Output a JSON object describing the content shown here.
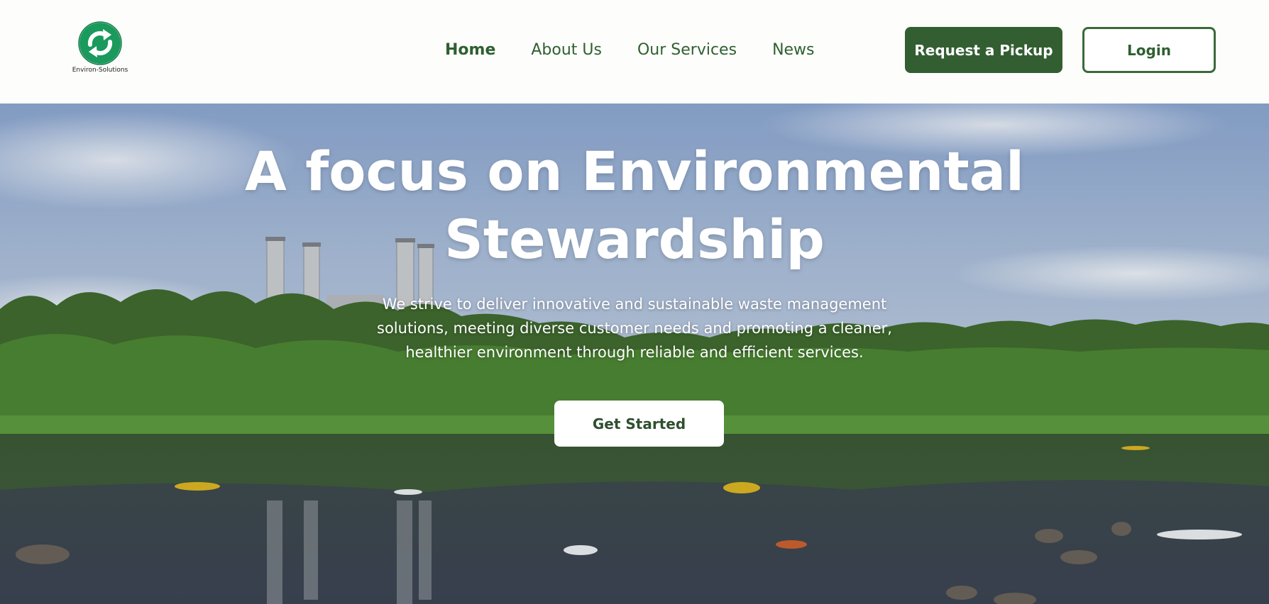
{
  "brand": {
    "name": "Environ-Solutions",
    "logo_icon": "recycle-arrows-icon",
    "logo_color": "#1a9a5c"
  },
  "nav": {
    "items": [
      {
        "label": "Home",
        "active": true
      },
      {
        "label": "About Us",
        "active": false
      },
      {
        "label": "Our Services",
        "active": false
      },
      {
        "label": "News",
        "active": false
      }
    ]
  },
  "header_actions": {
    "pickup_label": "Request a Pickup",
    "login_label": "Login"
  },
  "hero": {
    "title": "A focus on Environmental Stewardship",
    "subtitle": "We strive to deliver innovative and sustainable waste management solutions, meeting diverse customer needs and promoting a cleaner, healthier environment through reliable and efficient services.",
    "cta_label": "Get Started"
  },
  "colors": {
    "brand_green": "#335e32",
    "nav_text": "#2f5f31",
    "header_bg": "#fdfefb"
  }
}
